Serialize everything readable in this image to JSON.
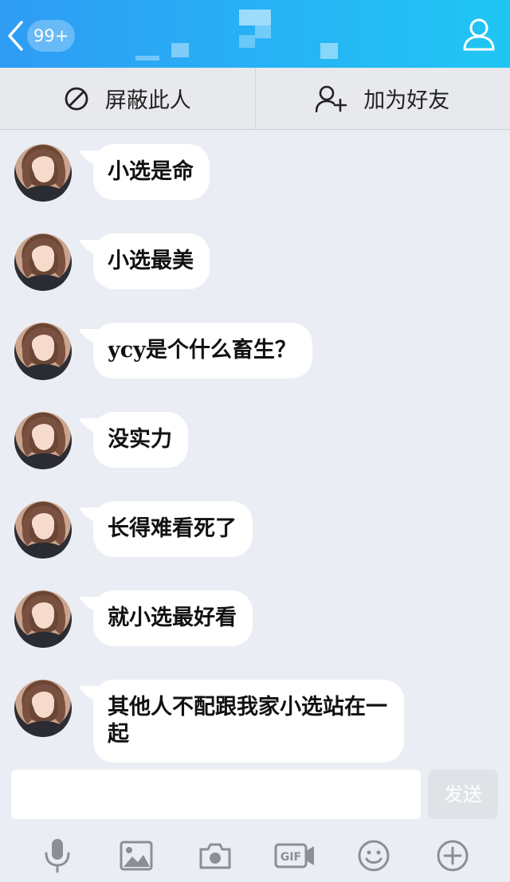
{
  "header": {
    "back_badge": "99+"
  },
  "actions": {
    "block_label": "屏蔽此人",
    "add_friend_label": "加为好友"
  },
  "messages": [
    {
      "text": "小选是命"
    },
    {
      "text": "小选最美"
    },
    {
      "text": "ycy是个什么畜生？"
    },
    {
      "text": "没实力"
    },
    {
      "text": "长得难看死了"
    },
    {
      "text": "就小选最好看"
    },
    {
      "text": "其他人不配跟我家小选站在一起"
    }
  ],
  "composer": {
    "send_label": "发送"
  },
  "toolbar": {
    "icons": [
      "microphone-icon",
      "image-icon",
      "camera-icon",
      "gif-icon",
      "emoji-icon",
      "plus-icon"
    ]
  },
  "colors": {
    "header_start": "#2f9cf4",
    "header_end": "#1fc6f3",
    "background": "#eaedf3",
    "bubble": "#ffffff",
    "icon_gray": "#8a8f97"
  }
}
